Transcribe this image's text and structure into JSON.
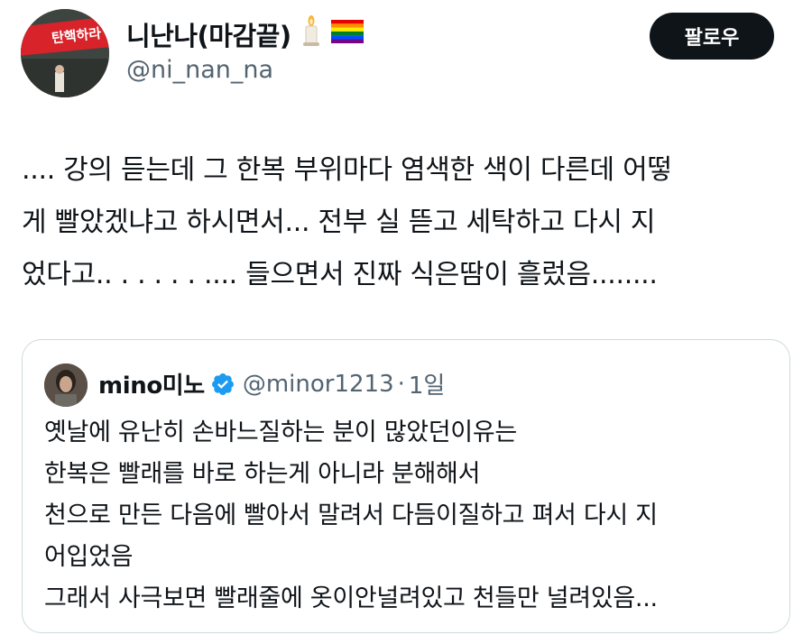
{
  "author": {
    "display_name": "니난나(마감끝)",
    "handle": "@ni_nan_na",
    "avatar_sign_text": "탄핵하라",
    "emoji": [
      "candle-icon",
      "rainbow-flag-icon"
    ]
  },
  "follow_label": "팔로우",
  "tweet": {
    "lines": [
      ".... 강의 듣는데 그 한복 부위마다 염색한 색이 다른데 어떻",
      "게 빨았겠냐고 하시면서... 전부 실 뜯고 세탁하고 다시 지",
      "었다고.. . . . . . .... 들으면서 진짜 식은땀이 흘렀음........"
    ]
  },
  "quote": {
    "display_name": "mino미노",
    "handle": "@minor1213",
    "separator": "·",
    "time": "1일",
    "lines": [
      "옛날에 유난히 손바느질하는 분이 많았던이유는",
      "한복은 빨래를 바로 하는게 아니라 분해해서",
      "천으로 만든 다음에 빨아서 말려서 다듬이질하고 펴서 다시 지",
      "어입었음",
      "그래서 사극보면 빨래줄에 옷이안널려있고 천들만 널려있음..."
    ]
  },
  "colors": {
    "text": "#0f1419",
    "secondary": "#536471",
    "border": "#cfd9de",
    "verified": "#1d9bf0",
    "button_bg": "#0f1419"
  }
}
